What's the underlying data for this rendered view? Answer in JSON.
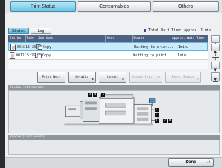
{
  "tabs": [
    {
      "label": "Print Status",
      "active": true
    },
    {
      "label": "Consumables",
      "active": false
    },
    {
      "label": "Others",
      "active": false
    }
  ],
  "subtabs": [
    {
      "label": "Status",
      "active": true
    },
    {
      "label": "Log",
      "active": false
    }
  ],
  "total_wait": {
    "label": "Total Wait Time: Approx.",
    "value": "1 min."
  },
  "table": {
    "columns": [
      "Job No.",
      "Time",
      "Job Name",
      "User",
      "Status",
      "Approx. Wait Time"
    ],
    "rows": [
      {
        "job_no": "0016",
        "time": "15:28",
        "job_name": "Copy",
        "user": "",
        "status": "Waiting to print...",
        "wait": "1min.",
        "selected": true
      },
      {
        "job_no": "0017",
        "time": "15:29",
        "job_name": "Copy",
        "user": "",
        "status": "Waiting to print...",
        "wait": "1min.",
        "selected": false
      }
    ]
  },
  "pager": {
    "current": "1",
    "total": "1"
  },
  "actions": {
    "print_next": "Print Next",
    "details": "Details",
    "cancel": "Cancel",
    "change_priority": "Change Priority",
    "reset_status": "Reset Status"
  },
  "device_info": {
    "title": "Device Information",
    "tray_labels": [
      "3",
      "4",
      "5",
      "1",
      "2",
      "6",
      "7",
      "8"
    ]
  },
  "recovery": {
    "title": "Recovery Procedures"
  },
  "footer": {
    "done_label": "Done"
  },
  "colors": {
    "accent": "#6cc3e3",
    "header": "#4d6182",
    "status_blue": "#2c4e86"
  }
}
